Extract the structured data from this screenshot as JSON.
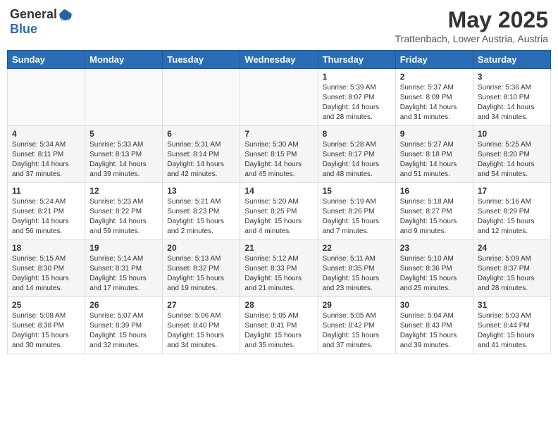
{
  "header": {
    "logo_general": "General",
    "logo_blue": "Blue",
    "month_title": "May 2025",
    "location": "Trattenbach, Lower Austria, Austria"
  },
  "days_of_week": [
    "Sunday",
    "Monday",
    "Tuesday",
    "Wednesday",
    "Thursday",
    "Friday",
    "Saturday"
  ],
  "weeks": [
    [
      {
        "day": "",
        "info": ""
      },
      {
        "day": "",
        "info": ""
      },
      {
        "day": "",
        "info": ""
      },
      {
        "day": "",
        "info": ""
      },
      {
        "day": "1",
        "info": "Sunrise: 5:39 AM\nSunset: 8:07 PM\nDaylight: 14 hours\nand 28 minutes."
      },
      {
        "day": "2",
        "info": "Sunrise: 5:37 AM\nSunset: 8:09 PM\nDaylight: 14 hours\nand 31 minutes."
      },
      {
        "day": "3",
        "info": "Sunrise: 5:36 AM\nSunset: 8:10 PM\nDaylight: 14 hours\nand 34 minutes."
      }
    ],
    [
      {
        "day": "4",
        "info": "Sunrise: 5:34 AM\nSunset: 8:11 PM\nDaylight: 14 hours\nand 37 minutes."
      },
      {
        "day": "5",
        "info": "Sunrise: 5:33 AM\nSunset: 8:13 PM\nDaylight: 14 hours\nand 39 minutes."
      },
      {
        "day": "6",
        "info": "Sunrise: 5:31 AM\nSunset: 8:14 PM\nDaylight: 14 hours\nand 42 minutes."
      },
      {
        "day": "7",
        "info": "Sunrise: 5:30 AM\nSunset: 8:15 PM\nDaylight: 14 hours\nand 45 minutes."
      },
      {
        "day": "8",
        "info": "Sunrise: 5:28 AM\nSunset: 8:17 PM\nDaylight: 14 hours\nand 48 minutes."
      },
      {
        "day": "9",
        "info": "Sunrise: 5:27 AM\nSunset: 8:18 PM\nDaylight: 14 hours\nand 51 minutes."
      },
      {
        "day": "10",
        "info": "Sunrise: 5:25 AM\nSunset: 8:20 PM\nDaylight: 14 hours\nand 54 minutes."
      }
    ],
    [
      {
        "day": "11",
        "info": "Sunrise: 5:24 AM\nSunset: 8:21 PM\nDaylight: 14 hours\nand 56 minutes."
      },
      {
        "day": "12",
        "info": "Sunrise: 5:23 AM\nSunset: 8:22 PM\nDaylight: 14 hours\nand 59 minutes."
      },
      {
        "day": "13",
        "info": "Sunrise: 5:21 AM\nSunset: 8:23 PM\nDaylight: 15 hours\nand 2 minutes."
      },
      {
        "day": "14",
        "info": "Sunrise: 5:20 AM\nSunset: 8:25 PM\nDaylight: 15 hours\nand 4 minutes."
      },
      {
        "day": "15",
        "info": "Sunrise: 5:19 AM\nSunset: 8:26 PM\nDaylight: 15 hours\nand 7 minutes."
      },
      {
        "day": "16",
        "info": "Sunrise: 5:18 AM\nSunset: 8:27 PM\nDaylight: 15 hours\nand 9 minutes."
      },
      {
        "day": "17",
        "info": "Sunrise: 5:16 AM\nSunset: 8:29 PM\nDaylight: 15 hours\nand 12 minutes."
      }
    ],
    [
      {
        "day": "18",
        "info": "Sunrise: 5:15 AM\nSunset: 8:30 PM\nDaylight: 15 hours\nand 14 minutes."
      },
      {
        "day": "19",
        "info": "Sunrise: 5:14 AM\nSunset: 8:31 PM\nDaylight: 15 hours\nand 17 minutes."
      },
      {
        "day": "20",
        "info": "Sunrise: 5:13 AM\nSunset: 8:32 PM\nDaylight: 15 hours\nand 19 minutes."
      },
      {
        "day": "21",
        "info": "Sunrise: 5:12 AM\nSunset: 8:33 PM\nDaylight: 15 hours\nand 21 minutes."
      },
      {
        "day": "22",
        "info": "Sunrise: 5:11 AM\nSunset: 8:35 PM\nDaylight: 15 hours\nand 23 minutes."
      },
      {
        "day": "23",
        "info": "Sunrise: 5:10 AM\nSunset: 8:36 PM\nDaylight: 15 hours\nand 25 minutes."
      },
      {
        "day": "24",
        "info": "Sunrise: 5:09 AM\nSunset: 8:37 PM\nDaylight: 15 hours\nand 28 minutes."
      }
    ],
    [
      {
        "day": "25",
        "info": "Sunrise: 5:08 AM\nSunset: 8:38 PM\nDaylight: 15 hours\nand 30 minutes."
      },
      {
        "day": "26",
        "info": "Sunrise: 5:07 AM\nSunset: 8:39 PM\nDaylight: 15 hours\nand 32 minutes."
      },
      {
        "day": "27",
        "info": "Sunrise: 5:06 AM\nSunset: 8:40 PM\nDaylight: 15 hours\nand 34 minutes."
      },
      {
        "day": "28",
        "info": "Sunrise: 5:05 AM\nSunset: 8:41 PM\nDaylight: 15 hours\nand 35 minutes."
      },
      {
        "day": "29",
        "info": "Sunrise: 5:05 AM\nSunset: 8:42 PM\nDaylight: 15 hours\nand 37 minutes."
      },
      {
        "day": "30",
        "info": "Sunrise: 5:04 AM\nSunset: 8:43 PM\nDaylight: 15 hours\nand 39 minutes."
      },
      {
        "day": "31",
        "info": "Sunrise: 5:03 AM\nSunset: 8:44 PM\nDaylight: 15 hours\nand 41 minutes."
      }
    ]
  ]
}
